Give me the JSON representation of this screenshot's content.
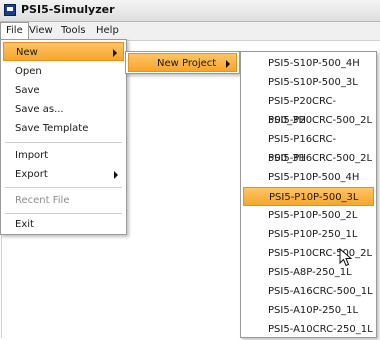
{
  "window": {
    "title": "PSI5-Simulyzer"
  },
  "menubar": {
    "items": [
      {
        "label": "File"
      },
      {
        "label": "View"
      },
      {
        "label": "Tools"
      },
      {
        "label": "Help"
      }
    ]
  },
  "file_menu": {
    "items": [
      {
        "label": "New"
      },
      {
        "label": "Open"
      },
      {
        "label": "Save"
      },
      {
        "label": "Save as..."
      },
      {
        "label": "Save Template"
      },
      {
        "label": "Import"
      },
      {
        "label": "Export"
      },
      {
        "label": "Recent File"
      },
      {
        "label": "Exit"
      }
    ]
  },
  "new_menu": {
    "items": [
      {
        "label": "New Project"
      }
    ]
  },
  "project_menu": {
    "items": [
      {
        "label": "PSI5-S10P-500_4H"
      },
      {
        "label": "PSI5-S10P-500_3L"
      },
      {
        "label": "PSI5-P20CRC-500_3H"
      },
      {
        "label": "PSI5-P20CRC-500_2L"
      },
      {
        "label": "PSI5-P16CRC-500_3H"
      },
      {
        "label": "PSI5-P16CRC-500_2L"
      },
      {
        "label": "PSI5-P10P-500_4H"
      },
      {
        "label": "PSI5-P10P-500_3L"
      },
      {
        "label": "PSI5-P10P-500_2L"
      },
      {
        "label": "PSI5-P10P-250_1L"
      },
      {
        "label": "PSI5-P10CRC-500_2L"
      },
      {
        "label": "PSI5-A8P-250_1L"
      },
      {
        "label": "PSI5-A16CRC-500_1L"
      },
      {
        "label": "PSI5-A10P-250_1L"
      },
      {
        "label": "PSI5-A10CRC-250_1L"
      }
    ]
  },
  "colors": {
    "highlight": "#f5a52b",
    "app_icon": "#1d3f8a"
  }
}
